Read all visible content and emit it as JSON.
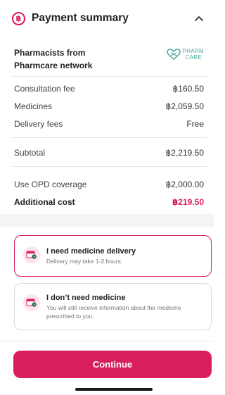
{
  "header": {
    "currency_symbol": "฿",
    "title": "Payment summary"
  },
  "provider": {
    "name": "Pharmacists from Pharmcare network",
    "logo_line1": "PHARM",
    "logo_line2": "CARE"
  },
  "fees": [
    {
      "label": "Consultation fee",
      "value": "฿160.50"
    },
    {
      "label": "Medicines",
      "value": "฿2,059.50"
    },
    {
      "label": "Delivery fees",
      "value": "Free"
    }
  ],
  "subtotal": {
    "label": "Subtotal",
    "value": "฿2,219.50"
  },
  "coverage": {
    "label": "Use OPD coverage",
    "value": "฿2,000.00"
  },
  "additional": {
    "label": "Additional cost",
    "value": "฿219.50"
  },
  "options": [
    {
      "title": "I need medicine delivery",
      "desc": "Delivery may take 1-2 hours.",
      "selected": true
    },
    {
      "title": "I don’t need medicine",
      "desc": "You will still receive information about the medicine prescribed to you.",
      "selected": false
    }
  ],
  "cta": {
    "label": "Continue"
  },
  "colors": {
    "accent": "#d81e5b",
    "logo": "#4aa89a"
  }
}
